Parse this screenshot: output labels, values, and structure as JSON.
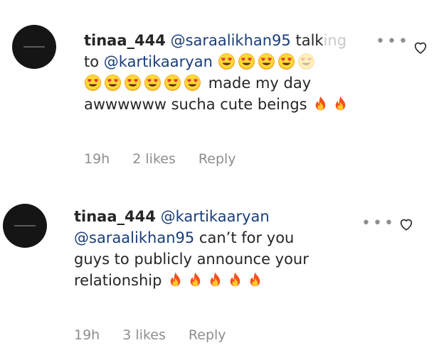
{
  "comments": [
    {
      "username": "tinaa_444",
      "mention1": "@saraalikhan95",
      "text1": "talk",
      "text1_faded": "ing",
      "word_to": "to",
      "mention2": "@kartikaaryan",
      "text2": "made my day",
      "text3": "awwwwww sucha cute beings",
      "time": "19h",
      "likes": "2 likes",
      "reply": "Reply",
      "emojis_line1": [
        "heart-eyes-emoji",
        "heart-eyes-emoji",
        "heart-eyes-emoji",
        "heart-eyes-emoji",
        "heart-eyes-emoji"
      ],
      "emojis_line2": [
        "heart-eyes-emoji",
        "heart-eyes-emoji",
        "heart-eyes-emoji",
        "heart-eyes-emoji",
        "heart-eyes-emoji",
        "heart-eyes-emoji"
      ],
      "emojis_line3": [
        "fire-emoji",
        "fire-emoji"
      ]
    },
    {
      "username": "tinaa_444",
      "mention1": "@kartikaaryan",
      "mention2": "@saraalikhan95",
      "text1": "can’t for you",
      "text2": "guys to publicly announce your",
      "text3": "relationship",
      "time": "19h",
      "likes": "3 likes",
      "reply": "Reply",
      "emojis": [
        "fire-emoji",
        "fire-emoji",
        "fire-emoji",
        "fire-emoji",
        "fire-emoji"
      ]
    }
  ],
  "icons": {
    "more": "more-horizontal-icon",
    "like": "heart-outline-icon"
  },
  "colors": {
    "mention": "#1a3e78",
    "meta": "#8e8e8e",
    "avatar": "#151515"
  }
}
